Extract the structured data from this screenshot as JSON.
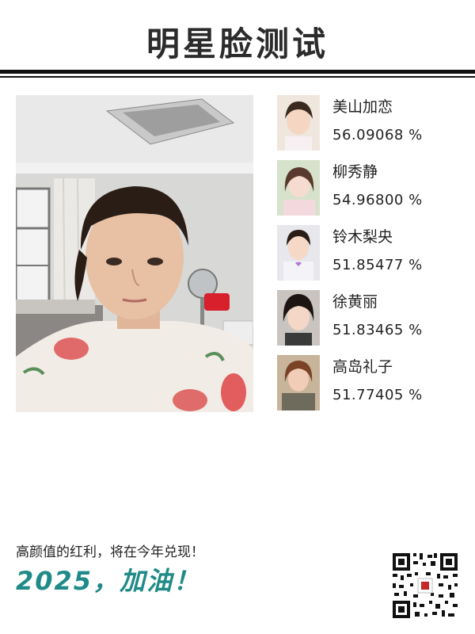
{
  "header": {
    "title": "明星脸测试"
  },
  "matches": [
    {
      "name": "美山加恋",
      "score": "56.09068 %"
    },
    {
      "name": "柳秀静",
      "score": "54.96800 %"
    },
    {
      "name": "铃木梨央",
      "score": "51.85477 %"
    },
    {
      "name": "徐黄丽",
      "score": "51.83465 %"
    },
    {
      "name": "高岛礼子",
      "score": "51.77405 %"
    }
  ],
  "footer": {
    "text": "高颜值的红利，将在今年兑现！",
    "slogan": "2025，加油！"
  },
  "colors": {
    "accent": "#1f8a88",
    "rule": "#111111"
  }
}
